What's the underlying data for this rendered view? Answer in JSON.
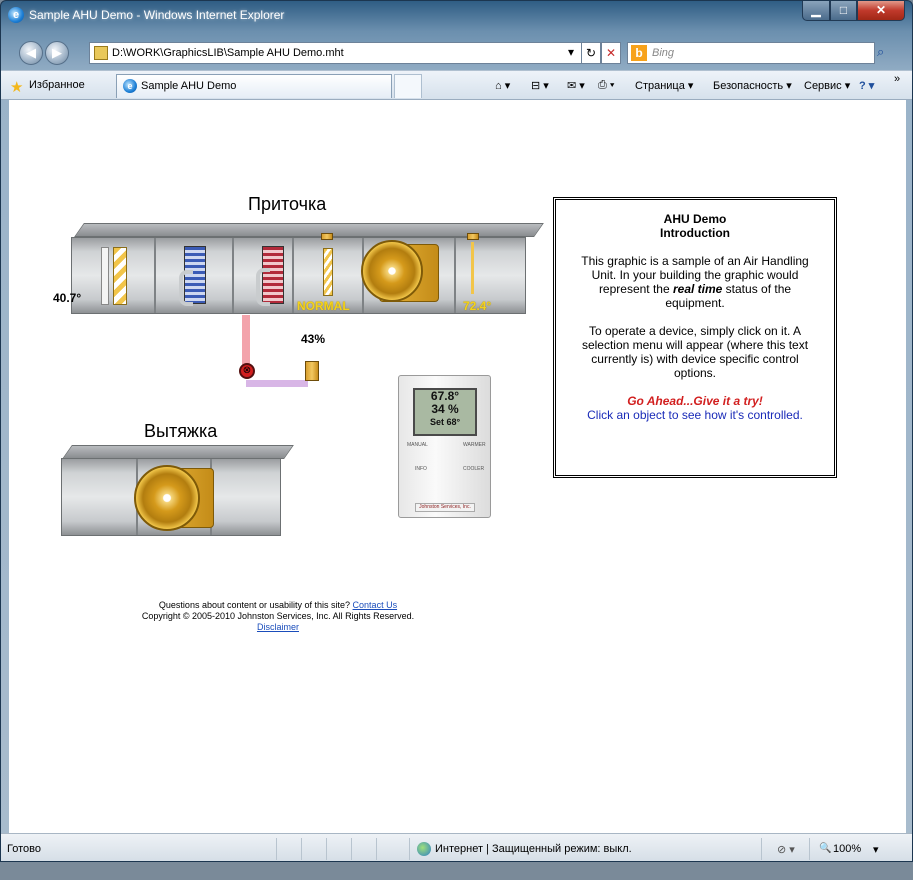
{
  "window": {
    "title": "Sample AHU Demo - Windows Internet Explorer",
    "min_glyph": "▁",
    "max_glyph": "□",
    "close_glyph": "✕"
  },
  "navbar": {
    "back_glyph": "◀",
    "forward_glyph": "▶",
    "address": "D:\\WORK\\GraphicsLIB\\Sample AHU Demo.mht",
    "dropdown_glyph": "▾",
    "refresh_glyph": "↻",
    "stop_glyph": "✕",
    "search_placeholder": "Bing",
    "bing_letter": "b",
    "search_go_glyph": "⌕"
  },
  "favbar": {
    "favorites_label": "Избранное",
    "tab_label": "Sample AHU Demo",
    "tools": [
      {
        "name": "home-button",
        "label": "⌂ ▾"
      },
      {
        "name": "feeds-button",
        "label": "⊟ ▾"
      },
      {
        "name": "mail-button",
        "label": "✉ ▾"
      },
      {
        "name": "print-button",
        "label": "⎙ ▾"
      },
      {
        "name": "page-menu",
        "label": "Страница ▾"
      },
      {
        "name": "safety-menu",
        "label": "Безопасность ▾"
      },
      {
        "name": "tools-menu",
        "label": "Сервис ▾"
      },
      {
        "name": "help-button",
        "label": "? ▾"
      },
      {
        "name": "more-button",
        "label": "»"
      }
    ]
  },
  "graphic": {
    "supply_heading": "Приточка",
    "exhaust_heading": "Вытяжка",
    "outdoor_temp": "40.7°",
    "fan_status": "NORMAL",
    "discharge_temp": "72.4°",
    "valve_position": "43%",
    "valve_glyph": "⊗",
    "thermostat": {
      "temp": "67.8°",
      "humidity": "34 %",
      "setpoint": "Set 68°",
      "manual": "MANUAL",
      "warmer": "WARMER",
      "info": "INFO",
      "cooler": "COOLER",
      "brand": "Johnston Services, Inc."
    }
  },
  "info_panel": {
    "title_line1": "AHU Demo",
    "title_line2": "Introduction",
    "para1_a": "This graphic is a sample of an Air Handling Unit. In your building the graphic would represent the ",
    "para1_em": "real time",
    "para1_b": " status of the equipment.",
    "para2": "To operate a device, simply click on it. A selection menu will appear (where this text currently is) with device specific control options.",
    "cta": "Go Ahead...Give it a try!",
    "hint": "Click an object to see how it's controlled."
  },
  "footer": {
    "question": "Questions about content or usability of this site?",
    "contact_link": "Contact Us",
    "copyright": "Copyright © 2005-2010 Johnston Services, Inc. All Rights Reserved.",
    "disclaimer_link": "Disclaimer"
  },
  "statusbar": {
    "status": "Готово",
    "zone": "Интернет | Защищенный режим: выкл.",
    "zoom": "100%",
    "protected_glyph": "⊘ ▾",
    "zoom_glyph": "🔍",
    "zoom_dropdown": "▾"
  }
}
